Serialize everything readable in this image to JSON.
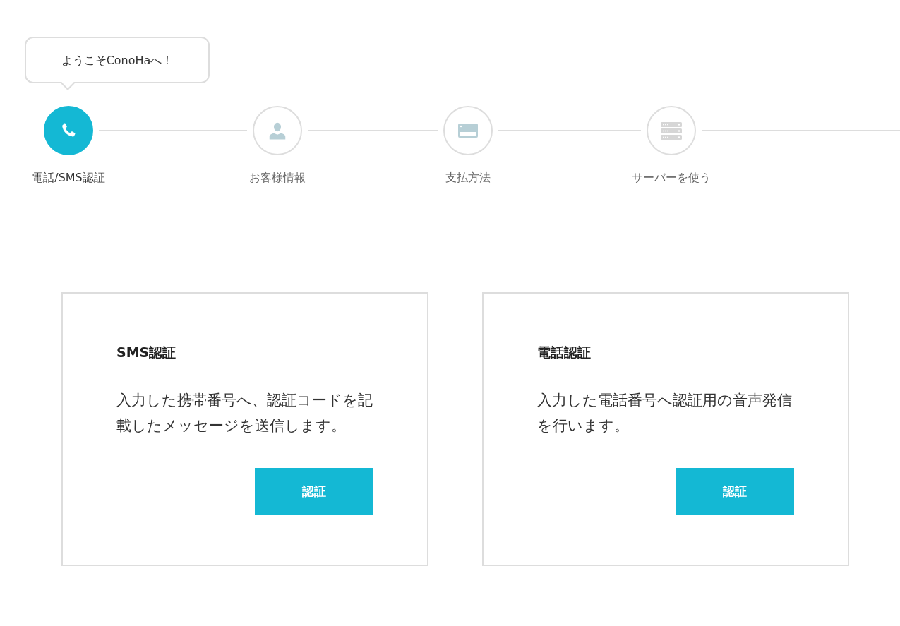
{
  "welcome_bubble": {
    "text": "ようこそConoHaへ！"
  },
  "steps": [
    {
      "kind": "phone",
      "label": "電話/SMS認証",
      "selected": true
    },
    {
      "kind": "person",
      "label": "お客様情報",
      "selected": false
    },
    {
      "kind": "card",
      "label": "支払方法",
      "selected": false
    },
    {
      "kind": "server",
      "label": "サーバーを使う",
      "selected": false
    }
  ],
  "panels": [
    {
      "title": "SMS認証",
      "description": "入力した携帯番号へ、認証コードを記載したメッセージを送信します。",
      "button": "認証"
    },
    {
      "title": "電話認証",
      "description": "入力した電話番号へ認証用の音声発信を行います。",
      "button": "認証"
    }
  ]
}
